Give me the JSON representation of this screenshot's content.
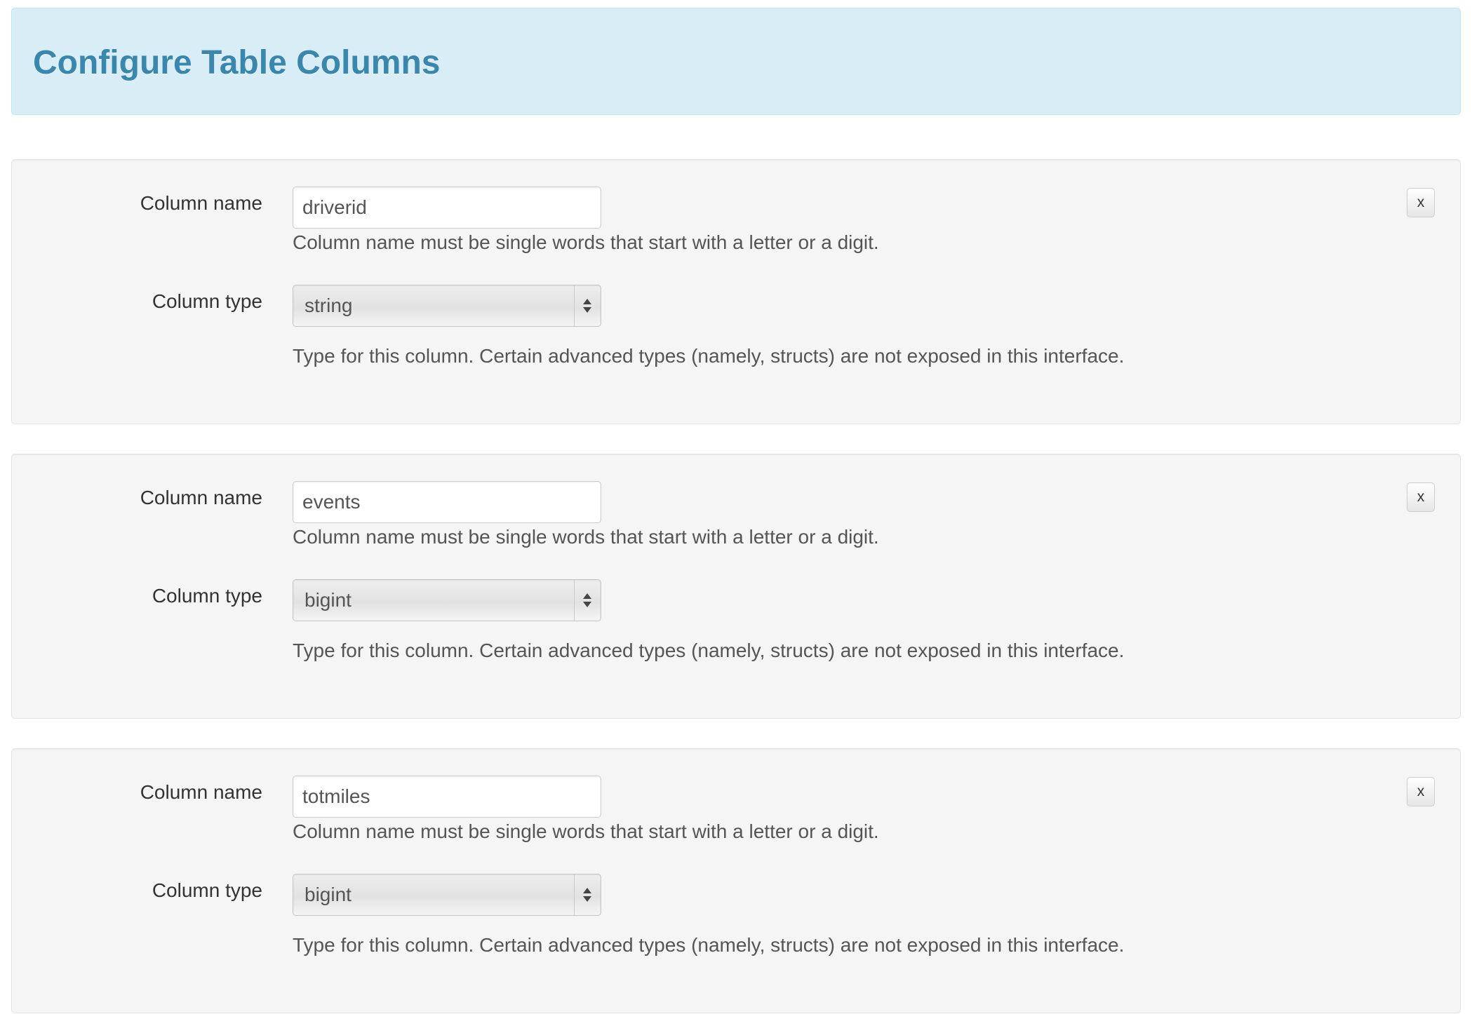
{
  "page": {
    "title": "Configure Table Columns"
  },
  "columns": [
    {
      "name_label": "Column name",
      "name_value": "driverid",
      "name_help": "Column name must be single words that start with a letter or a digit.",
      "type_label": "Column type",
      "type_value": "string",
      "type_help": "Type for this column. Certain advanced types (namely, structs) are not exposed in this interface.",
      "remove_label": "x"
    },
    {
      "name_label": "Column name",
      "name_value": "events",
      "name_help": "Column name must be single words that start with a letter or a digit.",
      "type_label": "Column type",
      "type_value": "bigint",
      "type_help": "Type for this column. Certain advanced types (namely, structs) are not exposed in this interface.",
      "remove_label": "x"
    },
    {
      "name_label": "Column name",
      "name_value": "totmiles",
      "name_help": "Column name must be single words that start with a letter or a digit.",
      "type_label": "Column type",
      "type_value": "bigint",
      "type_help": "Type for this column. Certain advanced types (namely, structs) are not exposed in this interface.",
      "remove_label": "x"
    }
  ],
  "colors": {
    "header_bg": "#d9edf7",
    "header_text": "#3a87ad",
    "panel_bg": "#f5f5f5"
  },
  "icons": {
    "select_arrow": "up-down-arrows-icon"
  }
}
